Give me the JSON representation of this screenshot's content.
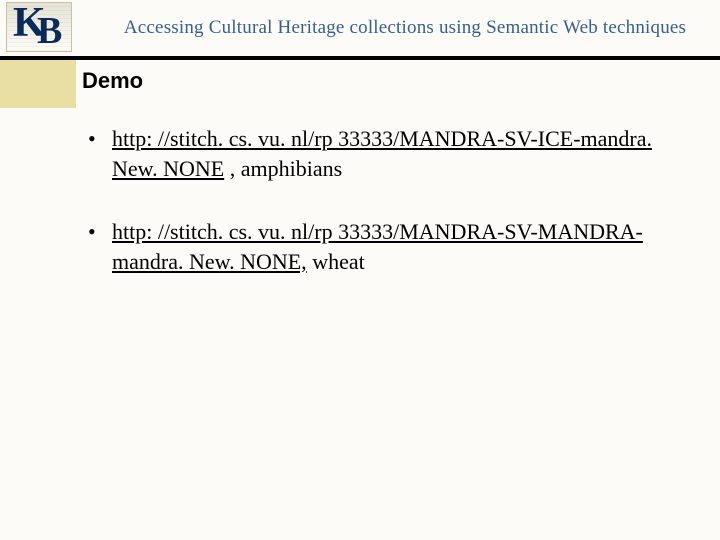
{
  "logo": {
    "letter1": "K",
    "letter2": "B"
  },
  "header": {
    "title": "Accessing Cultural Heritage collections using Semantic Web techniques"
  },
  "section_title": "Demo",
  "bullets": [
    {
      "link": "http: //stitch. cs. vu. nl/rp 33333/MANDRA-SV-ICE-mandra. New. NONE",
      "trail": " , amphibians"
    },
    {
      "link": "http: //stitch. cs. vu. nl/rp 33333/MANDRA-SV-MANDRA-mandra. New. NONE,",
      "trail": " wheat"
    }
  ]
}
